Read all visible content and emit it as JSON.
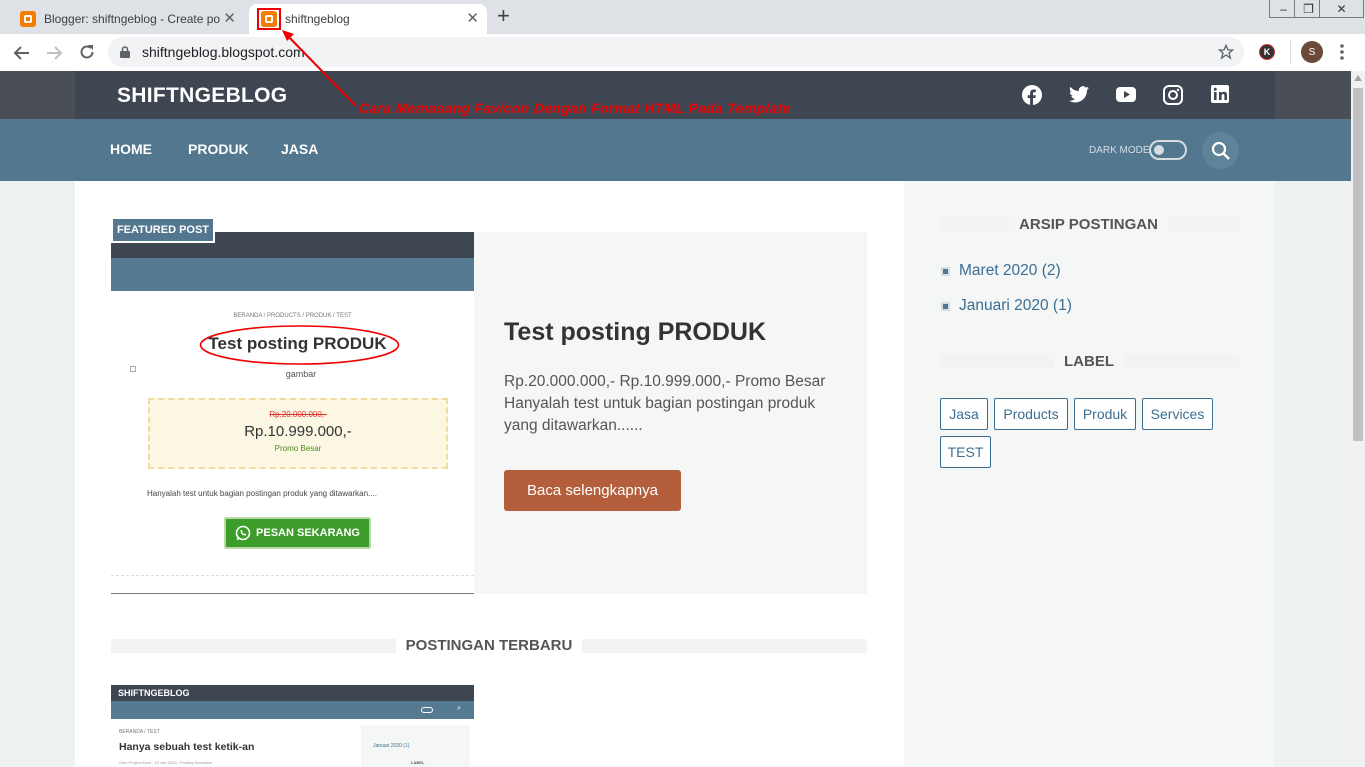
{
  "browser": {
    "tabs": [
      {
        "label": "Blogger: shiftngeblog - Create po"
      },
      {
        "label": "shiftngeblog"
      }
    ],
    "close_glyph": "✕",
    "new_tab_glyph": "+",
    "window_buttons": [
      "–",
      "❐",
      "✕"
    ],
    "url": "shiftngeblog.blogspot.com",
    "profile_initial": "S",
    "extension_initial": "K"
  },
  "annotation": {
    "text": "Cara Memasang Favicon Dengan Format HTML Pada Template",
    "color": "#ee0000"
  },
  "site": {
    "logo": "SHIFTNGEBLOG",
    "nav": [
      "HOME",
      "PRODUK",
      "JASA"
    ],
    "dark_mode_label": "DARK MODE",
    "social_icons": [
      "facebook-icon",
      "twitter-icon",
      "youtube-icon",
      "instagram-icon",
      "linkedin-icon"
    ],
    "colors": {
      "header_dark": "#3e4652",
      "nav_blue": "#53778e",
      "button": "#b55e3c",
      "link": "#3a6f92"
    }
  },
  "featured": {
    "badge": "FEATURED POST",
    "title": "Test posting PRODUK",
    "excerpt": "Rp.20.000.000,- Rp.10.999.000,- Promo Besar Hanyalah test untuk bagian postingan produk yang ditawarkan......",
    "read_more": "Baca selengkapnya",
    "thumb": {
      "breadcrumb": "BERANDA / PRODUCTS / PRODUK / TEST",
      "title": "Test posting PRODUK",
      "image_alt": "gambar",
      "old_price": "Rp.20.000.000,-",
      "price": "Rp.10.999.000,-",
      "promo": "Promo Besar",
      "desc": "Hanyalah test untuk bagian postingan produk yang ditawarkan....",
      "cta": "PESAN SEKARANG"
    }
  },
  "recent": {
    "title": "POSTINGAN TERBARU",
    "thumb": {
      "logo": "SHIFTNGEBLOG",
      "breadcrumb": "BERANDA / TEST",
      "title": "Hanya sebuah test ketik-an",
      "meta": "Oleh Project Asuri - 10 Jan 2020 - Posting Komentar",
      "side_item": "Januari 2020 (1)",
      "side_label": "LABEL"
    }
  },
  "sidebar": {
    "archive_title": "ARSIP POSTINGAN",
    "archive": [
      "Maret 2020 (2)",
      "Januari 2020 (1)"
    ],
    "label_title": "LABEL",
    "labels": [
      "Jasa",
      "Products",
      "Produk",
      "Services",
      "TEST"
    ]
  }
}
